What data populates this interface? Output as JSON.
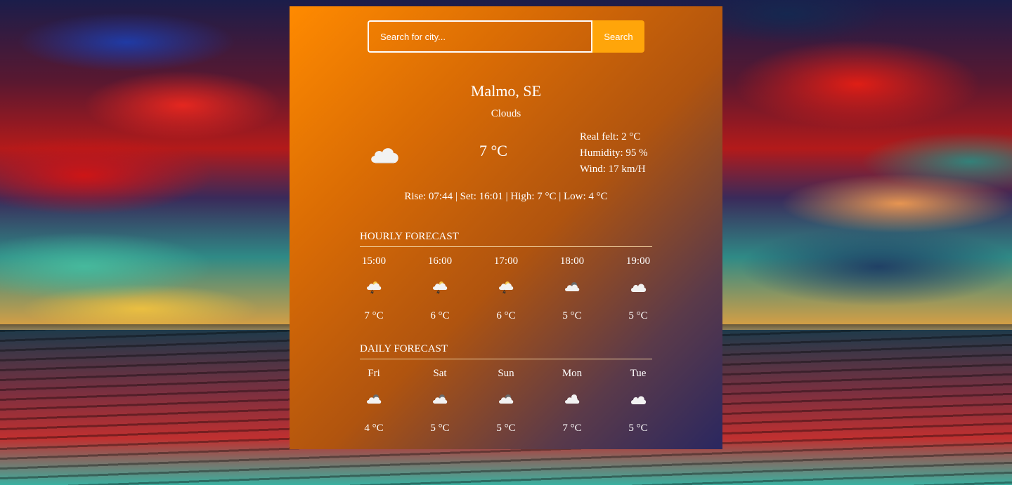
{
  "search": {
    "placeholder": "Search for city...",
    "button_label": "Search"
  },
  "current": {
    "city": "Malmo, SE",
    "condition": "Clouds",
    "icon": "cloud-icon",
    "temperature": "7 °C",
    "real_felt": "Real felt: 2 °C",
    "humidity": "Humidity: 95 %",
    "wind": "Wind: 17 km/H",
    "sun_line": "Rise: 07:44 | Set: 16:01 | High: 7 °C | Low: 4 °C"
  },
  "hourly": {
    "title": "HOURLY FORECAST",
    "items": [
      {
        "label": "15:00",
        "temp": "7 °C",
        "icon": "thunder-cloud-icon"
      },
      {
        "label": "16:00",
        "temp": "6 °C",
        "icon": "thunder-cloud-icon"
      },
      {
        "label": "17:00",
        "temp": "6 °C",
        "icon": "thunder-cloud-icon"
      },
      {
        "label": "18:00",
        "temp": "5 °C",
        "icon": "sun-behind-cloud-icon"
      },
      {
        "label": "19:00",
        "temp": "5 °C",
        "icon": "cloud-icon"
      }
    ]
  },
  "daily": {
    "title": "DAILY FORECAST",
    "items": [
      {
        "label": "Fri",
        "temp": "4 °C",
        "icon": "sun-behind-cloud-icon"
      },
      {
        "label": "Sat",
        "temp": "5 °C",
        "icon": "sun-behind-cloud-icon"
      },
      {
        "label": "Sun",
        "temp": "5 °C",
        "icon": "sun-behind-cloud-icon"
      },
      {
        "label": "Mon",
        "temp": "7 °C",
        "icon": "sun-behind-cloud-icon"
      },
      {
        "label": "Tue",
        "temp": "5 °C",
        "icon": "cloud-icon"
      }
    ]
  }
}
